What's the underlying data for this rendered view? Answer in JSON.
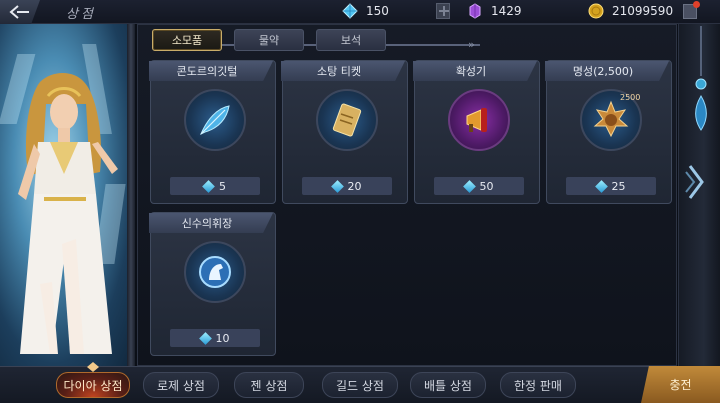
{
  "header": {
    "title": "상점",
    "currencies": [
      {
        "name": "diamond",
        "value": "150"
      },
      {
        "name": "purple-gem",
        "value": "1429"
      },
      {
        "name": "gold",
        "value": "21099590"
      }
    ]
  },
  "tabs": [
    {
      "label": "소모품",
      "active": true
    },
    {
      "label": "물약",
      "active": false
    },
    {
      "label": "보석",
      "active": false
    }
  ],
  "items": [
    {
      "name": "콘도르의깃털",
      "price": "5",
      "icon": "feather-icon"
    },
    {
      "name": "소탕 티켓",
      "price": "20",
      "icon": "ticket-icon"
    },
    {
      "name": "확성기",
      "price": "50",
      "icon": "megaphone-icon"
    },
    {
      "name": "명성(2,500)",
      "price": "25",
      "icon": "fame-medal-icon",
      "icon_text": "2500"
    },
    {
      "name": "신수의휘장",
      "price": "10",
      "icon": "horse-emblem-icon"
    }
  ],
  "bottom_tabs": [
    {
      "label": "다이아 상점",
      "active": true
    },
    {
      "label": "로제 상점",
      "active": false
    },
    {
      "label": "젠 상점",
      "active": false
    },
    {
      "label": "길드 상점",
      "active": false
    },
    {
      "label": "배틀 상점",
      "active": false
    },
    {
      "label": "한정 판매",
      "active": false
    }
  ],
  "recharge_label": "충전",
  "colors": {
    "accent_gold": "#c9ad6a",
    "active_tab_red": "#c04420",
    "card_header": "#4b5670",
    "recharge": "#c18a3a"
  }
}
